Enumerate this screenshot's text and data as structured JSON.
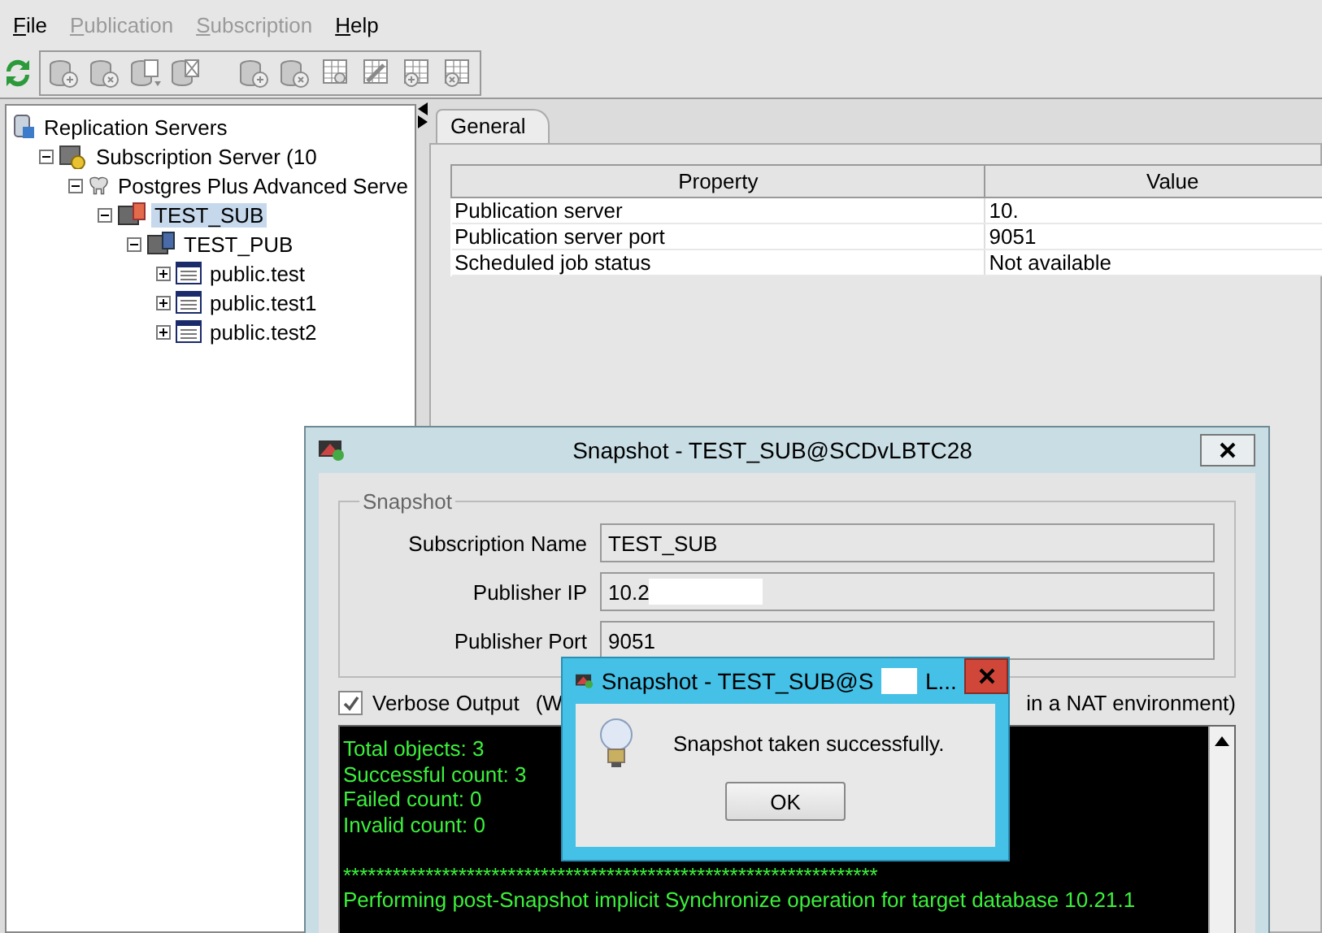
{
  "menu": [
    {
      "label": "File",
      "disabled": false
    },
    {
      "label": "Publication",
      "disabled": true
    },
    {
      "label": "Subscription",
      "disabled": true
    },
    {
      "label": "Help",
      "disabled": false
    }
  ],
  "toolbar": [
    {
      "kind": "refresh",
      "disabled": false
    },
    {
      "kind": "db-plus",
      "disabled": true
    },
    {
      "kind": "db-x",
      "disabled": true
    },
    {
      "kind": "db-doc",
      "disabled": true
    },
    {
      "kind": "db-edit",
      "disabled": true
    },
    {
      "kind": "db-plus",
      "disabled": true
    },
    {
      "kind": "db-x",
      "disabled": true
    },
    {
      "kind": "grid-search",
      "disabled": true
    },
    {
      "kind": "grid-link",
      "disabled": true
    },
    {
      "kind": "grid-plus",
      "disabled": true
    },
    {
      "kind": "grid-x",
      "disabled": true
    }
  ],
  "tree": [
    {
      "label": "Replication Servers",
      "kind": "servers",
      "selected": false,
      "children": [
        {
          "label": "Subscription Server (10",
          "kind": "server",
          "selected": false,
          "expanded": true,
          "children": [
            {
              "label": "Postgres Plus Advanced Serve",
              "kind": "postgres",
              "selected": false,
              "expanded": true,
              "children": [
                {
                  "label": "TEST_SUB",
                  "kind": "subscription",
                  "selected": true,
                  "expanded": true,
                  "children": [
                    {
                      "label": "TEST_PUB",
                      "kind": "publication",
                      "selected": false,
                      "expanded": true,
                      "children": [
                        {
                          "label": "public.test",
                          "kind": "table",
                          "selected": false,
                          "expanded": false
                        },
                        {
                          "label": "public.test1",
                          "kind": "table",
                          "selected": false,
                          "expanded": false
                        },
                        {
                          "label": "public.test2",
                          "kind": "table",
                          "selected": false,
                          "expanded": false
                        }
                      ]
                    }
                  ]
                }
              ]
            }
          ]
        }
      ]
    }
  ],
  "tabs": [
    {
      "label": "General",
      "selected": true
    }
  ],
  "properties": {
    "columns": [
      "Property",
      "Value"
    ],
    "rows": [
      [
        "Publication server",
        "10."
      ],
      [
        "Publication server port",
        "9051"
      ],
      [
        "Scheduled job status",
        "Not available"
      ]
    ]
  },
  "snapshot_dialog": {
    "title": "Snapshot - TEST_SUB@SCDvLBTC28",
    "group_title": "Snapshot",
    "fields": [
      {
        "label": "Subscription Name",
        "value": "TEST_SUB",
        "redacted": false
      },
      {
        "label": "Publisher IP",
        "value": "10.2",
        "redacted": true
      },
      {
        "label": "Publisher Port",
        "value": "9051",
        "redacted": false
      }
    ],
    "verbose": {
      "label": "Verbose Output",
      "checked": true,
      "note_start": "(W",
      "note_end": "in a NAT environment)"
    },
    "console_blocks": [
      [
        "Total objects: 3",
        "Successful count: 3",
        "Failed count: 0",
        "Invalid count: 0"
      ],
      [
        "*****************************************************************",
        "Performing post-Snapshot implicit Synchronize operation for target database 10.21.1"
      ]
    ]
  },
  "message_box": {
    "title": "Snapshot - TEST_SUB@S",
    "title_end": "L...",
    "message": "Snapshot taken successfully.",
    "button": "OK"
  }
}
